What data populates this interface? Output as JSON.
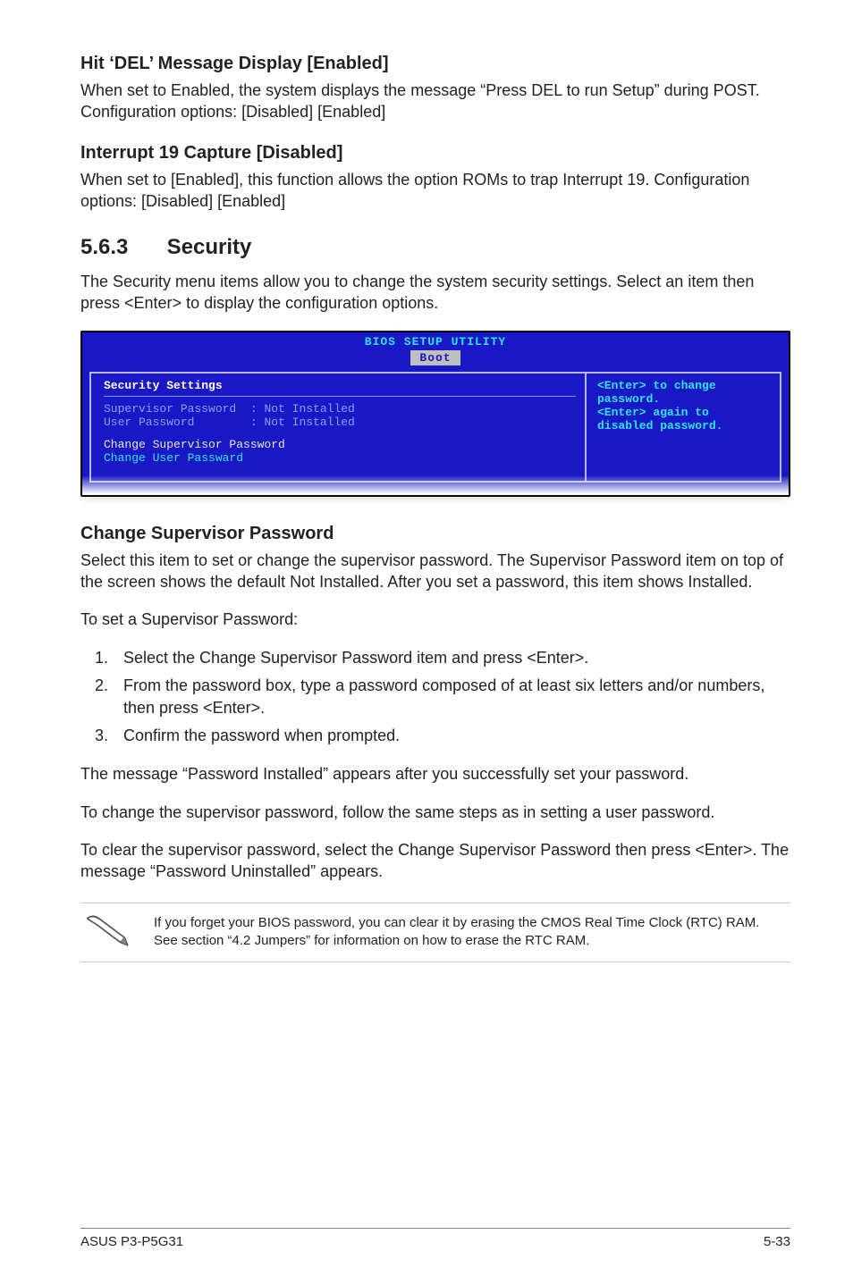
{
  "settings": {
    "hit_del": {
      "title": "Hit ‘DEL’ Message Display [Enabled]",
      "desc": "When set to Enabled, the system displays the message “Press DEL to run Setup” during POST. Configuration options: [Disabled] [Enabled]"
    },
    "int19": {
      "title": "Interrupt 19 Capture [Disabled]",
      "desc": "When set to [Enabled], this function allows the option ROMs to trap Interrupt 19. Configuration options: [Disabled] [Enabled]"
    },
    "change_sup": {
      "title": "Change Supervisor Password",
      "desc": "Select this item to set or change the supervisor password. The Supervisor Password item on top of the screen shows the default Not Installed. After you set a password, this item shows Installed."
    }
  },
  "section": {
    "number": "5.6.3",
    "name": "Security",
    "intro": "The Security menu items allow you to change the system security settings. Select an item then press <Enter> to display the configuration options."
  },
  "bios": {
    "header": "BIOS SETUP UTILITY",
    "tab": "Boot",
    "left_title": "Security Settings",
    "kv1_label": "Supervisor Password",
    "kv1_val": ": Not Installed",
    "kv2_label": "User Password",
    "kv2_val": ": Not Installed",
    "menu1": "Change Supervisor Password",
    "menu2": "Change User Passward",
    "help": "<Enter> to change password.\n<Enter> again to disabled password."
  },
  "procedure": {
    "lead": "To set a Supervisor Password:",
    "steps": [
      "Select the Change Supervisor Password item and press <Enter>.",
      "From the password box, type a password composed of at least six letters and/or numbers, then press <Enter>.",
      "Confirm the password when prompted."
    ],
    "after1": "The message “Password Installed” appears after you successfully set your password.",
    "after2": "To change the supervisor password, follow the same steps as in setting a user password.",
    "after3": "To clear the supervisor password, select the Change Supervisor Password then press <Enter>. The message “Password Uninstalled” appears."
  },
  "note": {
    "text": "If you forget your BIOS password, you can clear it by erasing the CMOS Real Time Clock (RTC) RAM. See section “4.2 Jumpers” for information on how to erase the RTC RAM."
  },
  "footer": {
    "left": "ASUS P3-P5G31",
    "right": "5-33"
  }
}
